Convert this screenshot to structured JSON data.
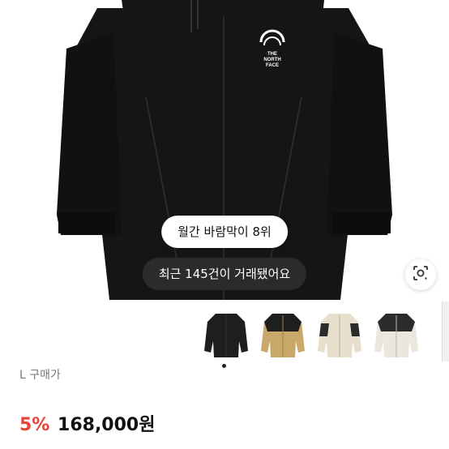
{
  "product": {
    "brand_logo_text": "THE NORTH FACE",
    "rank_badge": "월간 바람막이 8위",
    "trade_badge": "최근 145건이 거래됐어요",
    "size_label": "L",
    "size_suffix": "구매가",
    "discount": "5%",
    "price": "168,000원"
  },
  "thumbnails": [
    {
      "name": "black",
      "body": "#1e1e1e",
      "accent": "#1e1e1e"
    },
    {
      "name": "beige-black",
      "body": "#c9a86a",
      "accent": "#1e1e1e"
    },
    {
      "name": "cream-black",
      "body": "#e7dfcc",
      "accent": "#2b2b2b"
    },
    {
      "name": "ivory-black",
      "body": "#ebe7dc",
      "accent": "#2b2b2b"
    }
  ],
  "colors": {
    "jacket": "#151515",
    "discount": "#e8433a",
    "dark_pill": "#2b2b2b"
  },
  "icons": {
    "lens": "lens-search-icon"
  }
}
